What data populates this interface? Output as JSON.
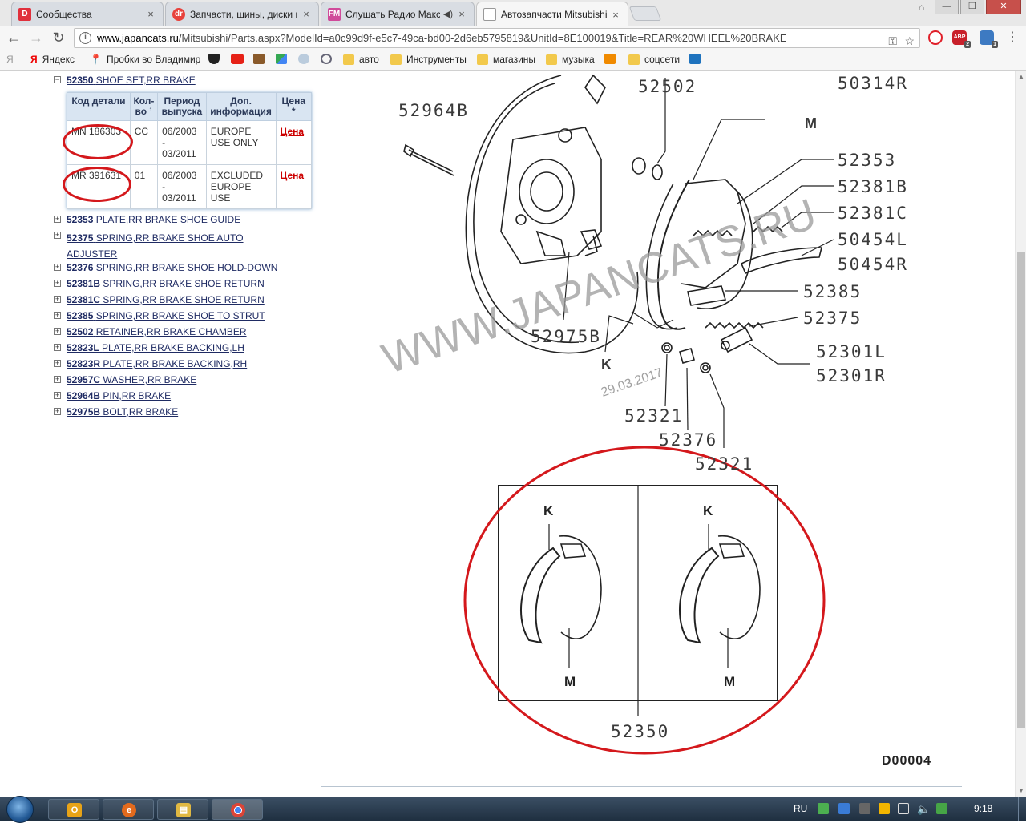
{
  "tabs": [
    {
      "title": "Сообщества",
      "favicon": "D",
      "favicon_color": "#e0303c",
      "active": false
    },
    {
      "title": "Запчасти, шины, диски и",
      "favicon": "dr",
      "favicon_color": "#e8413b",
      "active": false
    },
    {
      "title": "Слушать Радио Макси",
      "favicon": "FM",
      "favicon_color": "#d04a9a",
      "active": false
    },
    {
      "title": "Автозапчасти Mitsubishi",
      "favicon": "doc",
      "favicon_color": "#888888",
      "active": true
    }
  ],
  "omnibox": {
    "host": "www.japancats.ru",
    "path": "/Mitsubishi/Parts.aspx?ModelId=a0c99d9f-e5c7-49ca-bd00-2d6eb5795819&UnitId=8E100019&Title=REAR%20WHEEL%20BRAKE"
  },
  "extensions": [
    {
      "name": "opera-icon",
      "label": "O",
      "color": "#e0202a",
      "badge": ""
    },
    {
      "name": "adblock-icon",
      "label": "ABP",
      "color": "#c8202a",
      "badge": "2"
    },
    {
      "name": "extension-icon",
      "label": "",
      "color": "#3d7ac2",
      "badge": "1"
    }
  ],
  "bookmarks": [
    {
      "label": "Я",
      "icon": "yandex-small-icon"
    },
    {
      "label": "Яндекс",
      "icon": "yandex-icon"
    },
    {
      "label": "Пробки во Владимир",
      "icon": "map-pin-icon"
    },
    {
      "label": "",
      "icon": "shield-icon"
    },
    {
      "label": "",
      "icon": "youtube-icon"
    },
    {
      "label": "",
      "icon": "photo-icon"
    },
    {
      "label": "",
      "icon": "maps-icon"
    },
    {
      "label": "",
      "icon": "link-icon"
    },
    {
      "label": "",
      "icon": "circle-icon"
    },
    {
      "label": "авто",
      "icon": "folder-icon"
    },
    {
      "label": "Инструменты",
      "icon": "folder-icon"
    },
    {
      "label": "магазины",
      "icon": "folder-icon"
    },
    {
      "label": "музыка",
      "icon": "folder-icon"
    },
    {
      "label": "",
      "icon": "ok-icon"
    },
    {
      "label": "соцсети",
      "icon": "folder-icon"
    },
    {
      "label": "",
      "icon": "d-icon"
    }
  ],
  "parts_tree": {
    "expanded": {
      "code": "52350",
      "name": "SHOE SET,RR BRAKE",
      "toggle": "⊟"
    },
    "table": {
      "headers": [
        "Код детали",
        "Кол-во ¹",
        "Период выпуска",
        "Доп. информация",
        "Цена *"
      ],
      "rows": [
        {
          "code": "MN 186303",
          "qty": "CC",
          "period": "06/2003\n-\n03/2011",
          "info": "EUROPE USE ONLY",
          "price": "Цена"
        },
        {
          "code": "MR 391631",
          "qty": "01",
          "period": "06/2003\n-\n03/2011",
          "info": "EXCLUDED EUROPE USE",
          "price": "Цена"
        }
      ]
    },
    "items": [
      {
        "code": "52353",
        "name": "PLATE,RR BRAKE SHOE GUIDE"
      },
      {
        "code": "52375",
        "name": "SPRING,RR BRAKE SHOE AUTO ADJUSTER"
      },
      {
        "code": "52376",
        "name": "SPRING,RR BRAKE SHOE HOLD-DOWN"
      },
      {
        "code": "52381B",
        "name": "SPRING,RR BRAKE SHOE RETURN"
      },
      {
        "code": "52381C",
        "name": "SPRING,RR BRAKE SHOE RETURN"
      },
      {
        "code": "52385",
        "name": "SPRING,RR BRAKE SHOE TO STRUT"
      },
      {
        "code": "52502",
        "name": "RETAINER,RR BRAKE CHAMBER"
      },
      {
        "code": "52823L",
        "name": "PLATE,RR BRAKE BACKING,LH"
      },
      {
        "code": "52823R",
        "name": "PLATE,RR BRAKE BACKING,RH"
      },
      {
        "code": "52957C",
        "name": "WASHER,RR BRAKE"
      },
      {
        "code": "52964B",
        "name": "PIN,RR BRAKE"
      },
      {
        "code": "52975B",
        "name": "BOLT,RR BRAKE"
      }
    ]
  },
  "diagram": {
    "callouts": {
      "c52502": "52502",
      "c50314r": "50314R",
      "c52964b": "52964B",
      "cM": "M",
      "c52353": "52353",
      "c52381b": "52381B",
      "c52381c": "52381C",
      "c50454l": "50454L",
      "c50454r": "50454R",
      "c52385": "52385",
      "c52375": "52375",
      "c52975b": "52975B",
      "cK": "K",
      "c52301l": "52301L",
      "c52301r": "52301R",
      "c52321a": "52321",
      "c52376": "52376",
      "c52321b": "52321",
      "c52350": "52350",
      "kL": "K",
      "kR": "K",
      "mL": "M",
      "mR": "M"
    },
    "watermark": "WWW.JAPANCATS.RU",
    "watermark_date": "29.03.2017",
    "diagram_id": "D00004"
  },
  "taskbar": {
    "language": "RU",
    "clock": "9:18",
    "apps": [
      {
        "name": "outlook",
        "label": "O",
        "color": "#e8a317",
        "active": false
      },
      {
        "name": "browser-old",
        "label": "e",
        "color": "#e26a1d",
        "active": false
      },
      {
        "name": "explorer",
        "label": "▤",
        "color": "#e0b842",
        "active": false
      },
      {
        "name": "chrome",
        "label": "◉",
        "color": "#3a9d4a",
        "active": true
      }
    ]
  }
}
